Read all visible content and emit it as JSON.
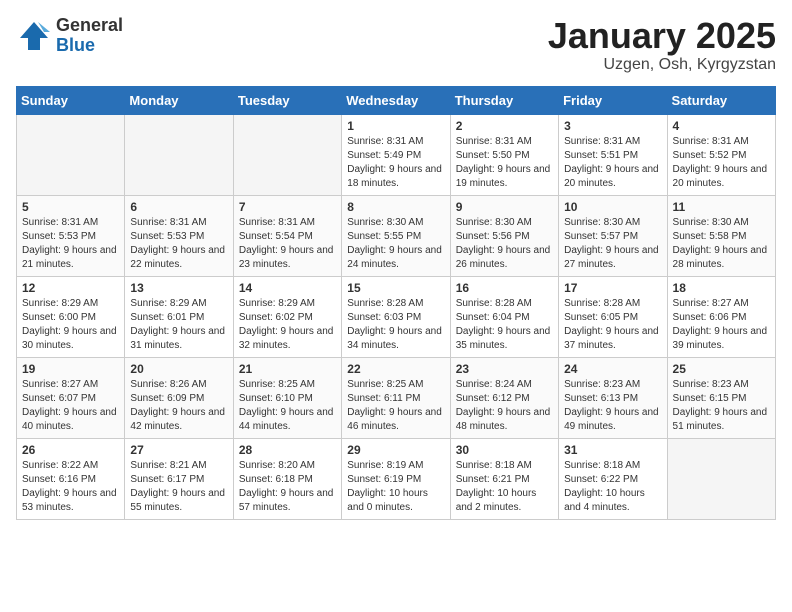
{
  "logo": {
    "general": "General",
    "blue": "Blue"
  },
  "title": "January 2025",
  "subtitle": "Uzgen, Osh, Kyrgyzstan",
  "days_of_week": [
    "Sunday",
    "Monday",
    "Tuesday",
    "Wednesday",
    "Thursday",
    "Friday",
    "Saturday"
  ],
  "weeks": [
    [
      {
        "day": null
      },
      {
        "day": null
      },
      {
        "day": null
      },
      {
        "day": "1",
        "sunrise": "Sunrise: 8:31 AM",
        "sunset": "Sunset: 5:49 PM",
        "daylight": "Daylight: 9 hours and 18 minutes."
      },
      {
        "day": "2",
        "sunrise": "Sunrise: 8:31 AM",
        "sunset": "Sunset: 5:50 PM",
        "daylight": "Daylight: 9 hours and 19 minutes."
      },
      {
        "day": "3",
        "sunrise": "Sunrise: 8:31 AM",
        "sunset": "Sunset: 5:51 PM",
        "daylight": "Daylight: 9 hours and 20 minutes."
      },
      {
        "day": "4",
        "sunrise": "Sunrise: 8:31 AM",
        "sunset": "Sunset: 5:52 PM",
        "daylight": "Daylight: 9 hours and 20 minutes."
      }
    ],
    [
      {
        "day": "5",
        "sunrise": "Sunrise: 8:31 AM",
        "sunset": "Sunset: 5:53 PM",
        "daylight": "Daylight: 9 hours and 21 minutes."
      },
      {
        "day": "6",
        "sunrise": "Sunrise: 8:31 AM",
        "sunset": "Sunset: 5:53 PM",
        "daylight": "Daylight: 9 hours and 22 minutes."
      },
      {
        "day": "7",
        "sunrise": "Sunrise: 8:31 AM",
        "sunset": "Sunset: 5:54 PM",
        "daylight": "Daylight: 9 hours and 23 minutes."
      },
      {
        "day": "8",
        "sunrise": "Sunrise: 8:30 AM",
        "sunset": "Sunset: 5:55 PM",
        "daylight": "Daylight: 9 hours and 24 minutes."
      },
      {
        "day": "9",
        "sunrise": "Sunrise: 8:30 AM",
        "sunset": "Sunset: 5:56 PM",
        "daylight": "Daylight: 9 hours and 26 minutes."
      },
      {
        "day": "10",
        "sunrise": "Sunrise: 8:30 AM",
        "sunset": "Sunset: 5:57 PM",
        "daylight": "Daylight: 9 hours and 27 minutes."
      },
      {
        "day": "11",
        "sunrise": "Sunrise: 8:30 AM",
        "sunset": "Sunset: 5:58 PM",
        "daylight": "Daylight: 9 hours and 28 minutes."
      }
    ],
    [
      {
        "day": "12",
        "sunrise": "Sunrise: 8:29 AM",
        "sunset": "Sunset: 6:00 PM",
        "daylight": "Daylight: 9 hours and 30 minutes."
      },
      {
        "day": "13",
        "sunrise": "Sunrise: 8:29 AM",
        "sunset": "Sunset: 6:01 PM",
        "daylight": "Daylight: 9 hours and 31 minutes."
      },
      {
        "day": "14",
        "sunrise": "Sunrise: 8:29 AM",
        "sunset": "Sunset: 6:02 PM",
        "daylight": "Daylight: 9 hours and 32 minutes."
      },
      {
        "day": "15",
        "sunrise": "Sunrise: 8:28 AM",
        "sunset": "Sunset: 6:03 PM",
        "daylight": "Daylight: 9 hours and 34 minutes."
      },
      {
        "day": "16",
        "sunrise": "Sunrise: 8:28 AM",
        "sunset": "Sunset: 6:04 PM",
        "daylight": "Daylight: 9 hours and 35 minutes."
      },
      {
        "day": "17",
        "sunrise": "Sunrise: 8:28 AM",
        "sunset": "Sunset: 6:05 PM",
        "daylight": "Daylight: 9 hours and 37 minutes."
      },
      {
        "day": "18",
        "sunrise": "Sunrise: 8:27 AM",
        "sunset": "Sunset: 6:06 PM",
        "daylight": "Daylight: 9 hours and 39 minutes."
      }
    ],
    [
      {
        "day": "19",
        "sunrise": "Sunrise: 8:27 AM",
        "sunset": "Sunset: 6:07 PM",
        "daylight": "Daylight: 9 hours and 40 minutes."
      },
      {
        "day": "20",
        "sunrise": "Sunrise: 8:26 AM",
        "sunset": "Sunset: 6:09 PM",
        "daylight": "Daylight: 9 hours and 42 minutes."
      },
      {
        "day": "21",
        "sunrise": "Sunrise: 8:25 AM",
        "sunset": "Sunset: 6:10 PM",
        "daylight": "Daylight: 9 hours and 44 minutes."
      },
      {
        "day": "22",
        "sunrise": "Sunrise: 8:25 AM",
        "sunset": "Sunset: 6:11 PM",
        "daylight": "Daylight: 9 hours and 46 minutes."
      },
      {
        "day": "23",
        "sunrise": "Sunrise: 8:24 AM",
        "sunset": "Sunset: 6:12 PM",
        "daylight": "Daylight: 9 hours and 48 minutes."
      },
      {
        "day": "24",
        "sunrise": "Sunrise: 8:23 AM",
        "sunset": "Sunset: 6:13 PM",
        "daylight": "Daylight: 9 hours and 49 minutes."
      },
      {
        "day": "25",
        "sunrise": "Sunrise: 8:23 AM",
        "sunset": "Sunset: 6:15 PM",
        "daylight": "Daylight: 9 hours and 51 minutes."
      }
    ],
    [
      {
        "day": "26",
        "sunrise": "Sunrise: 8:22 AM",
        "sunset": "Sunset: 6:16 PM",
        "daylight": "Daylight: 9 hours and 53 minutes."
      },
      {
        "day": "27",
        "sunrise": "Sunrise: 8:21 AM",
        "sunset": "Sunset: 6:17 PM",
        "daylight": "Daylight: 9 hours and 55 minutes."
      },
      {
        "day": "28",
        "sunrise": "Sunrise: 8:20 AM",
        "sunset": "Sunset: 6:18 PM",
        "daylight": "Daylight: 9 hours and 57 minutes."
      },
      {
        "day": "29",
        "sunrise": "Sunrise: 8:19 AM",
        "sunset": "Sunset: 6:19 PM",
        "daylight": "Daylight: 10 hours and 0 minutes."
      },
      {
        "day": "30",
        "sunrise": "Sunrise: 8:18 AM",
        "sunset": "Sunset: 6:21 PM",
        "daylight": "Daylight: 10 hours and 2 minutes."
      },
      {
        "day": "31",
        "sunrise": "Sunrise: 8:18 AM",
        "sunset": "Sunset: 6:22 PM",
        "daylight": "Daylight: 10 hours and 4 minutes."
      },
      {
        "day": null
      }
    ]
  ]
}
